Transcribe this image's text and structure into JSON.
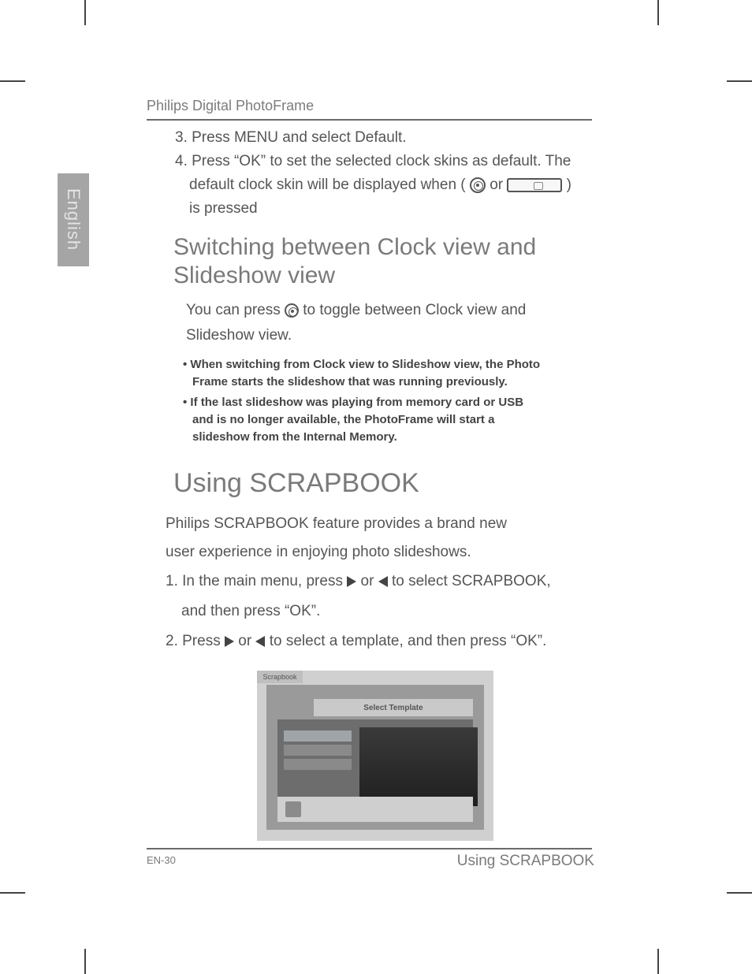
{
  "header": {
    "product": "Philips Digital PhotoFrame"
  },
  "lang_tab": "English",
  "steps_top": {
    "s3": "3. Press MENU and select Default.",
    "s4a": "4. Press “OK” to set the selected clock skins as default. The",
    "s4b": "default clock skin will be displayed when  (",
    "s4c": " or ",
    "s4d": ")",
    "s4e": "is pressed"
  },
  "h2": "Switching between Clock view and Slideshow view",
  "toggle": {
    "p1a": "You can press ",
    "p1b": " to toggle between Clock view and",
    "p2": "Slideshow view."
  },
  "notes": {
    "n1a": "• When switching from Clock view to Slideshow view, the Photo",
    "n1b": "Frame starts the slideshow that was running previously.",
    "n2a": "• If the last slideshow was playing from memory card or USB",
    "n2b": "and is no longer available, the PhotoFrame will start a",
    "n2c": "slideshow from the Internal Memory."
  },
  "h1": "Using SCRAPBOOK",
  "scrap": {
    "intro1": "Philips SCRAPBOOK feature provides a brand new",
    "intro2": "user experience in enjoying photo slideshows.",
    "s1a": "1. In the main menu, press  ",
    "s1b": " or  ",
    "s1c": "to select SCRAPBOOK,",
    "s1d": "and then press “OK”.",
    "s2a": "2. Press ",
    "s2b": " or  ",
    "s2c": "to select a template, and then press “OK”."
  },
  "screenshot": {
    "tab": "Scrapbook",
    "title": "Select Template",
    "menu": [
      "",
      "",
      ""
    ],
    "page": ""
  },
  "footer": {
    "left": "EN-30",
    "right": "Using SCRAPBOOK"
  }
}
